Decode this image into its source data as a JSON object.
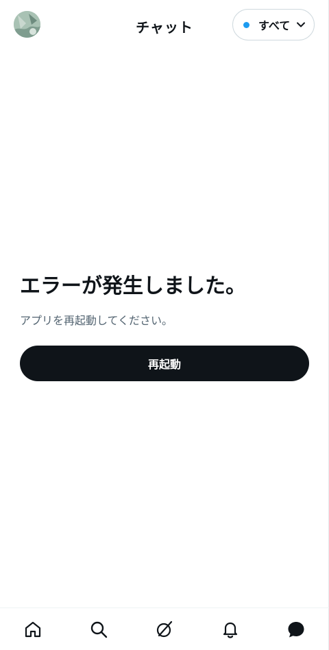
{
  "header": {
    "title": "チャット",
    "filter_label": "すべて",
    "filter_dot_color": "#1d9bf0"
  },
  "error": {
    "title": "エラーが発生しました。",
    "description": "アプリを再起動してください。",
    "button_label": "再起動"
  },
  "bottom_nav": {
    "items": [
      {
        "icon": "home-icon"
      },
      {
        "icon": "search-icon"
      },
      {
        "icon": "grok-icon"
      },
      {
        "icon": "bell-icon"
      },
      {
        "icon": "chat-icon",
        "active": true
      }
    ]
  },
  "colors": {
    "text": "#0f1419",
    "muted": "#536471",
    "button_bg": "#0f1419",
    "accent": "#1d9bf0"
  }
}
